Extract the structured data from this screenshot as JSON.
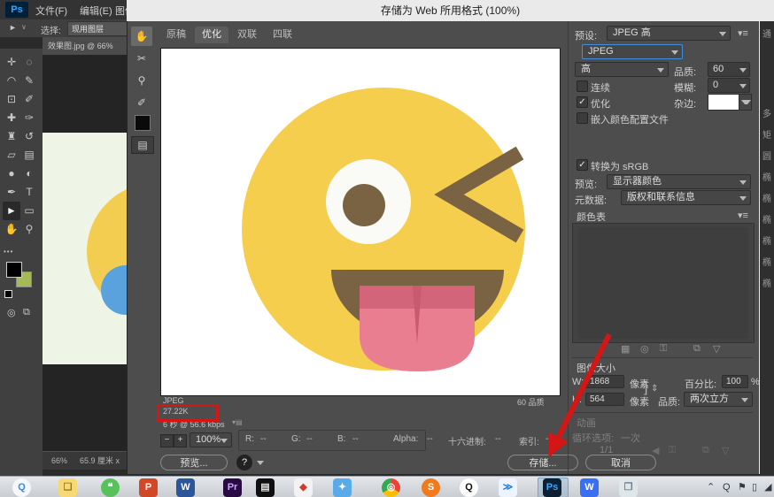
{
  "menubar": {
    "logo": "Ps",
    "items": [
      {
        "label": "文件(F)"
      },
      {
        "label": "编辑(E)"
      },
      {
        "label": "图像"
      }
    ]
  },
  "optionsbar": {
    "tool_glyph": "►",
    "caret_glyph": "∨",
    "select_label": "选择:",
    "select_value": "现用图层"
  },
  "toolpanel": {
    "tools": [
      {
        "name": "move-tool",
        "glyph": "✛"
      },
      {
        "name": "marquee-tool",
        "glyph": "◌"
      },
      {
        "name": "lasso-tool",
        "glyph": "◠"
      },
      {
        "name": "quick-selection-tool",
        "glyph": "✎"
      },
      {
        "name": "crop-tool",
        "glyph": "⊡"
      },
      {
        "name": "eyedropper-tool",
        "glyph": "✐"
      },
      {
        "name": "healing-brush-tool",
        "glyph": "✚"
      },
      {
        "name": "brush-tool",
        "glyph": "✑"
      },
      {
        "name": "clone-stamp-tool",
        "glyph": "♜"
      },
      {
        "name": "history-brush-tool",
        "glyph": "↺"
      },
      {
        "name": "eraser-tool",
        "glyph": "▱"
      },
      {
        "name": "gradient-tool",
        "glyph": "▤"
      },
      {
        "name": "blur-tool",
        "glyph": "●"
      },
      {
        "name": "dodge-tool",
        "glyph": "◐"
      },
      {
        "name": "pen-tool",
        "glyph": "✒"
      },
      {
        "name": "type-tool",
        "glyph": "T"
      },
      {
        "name": "path-selection-tool",
        "glyph": "►",
        "selected": true
      },
      {
        "name": "rectangle-tool",
        "glyph": "▭"
      },
      {
        "name": "hand-tool",
        "glyph": "✋"
      },
      {
        "name": "zoom-tool",
        "glyph": "⚲"
      }
    ],
    "more_glyph": "•••",
    "foreground_color": "#000000",
    "background_color": "#a6b959"
  },
  "document": {
    "tab_title": "效果图.jpg @ 66%",
    "zoom": "66%",
    "dimensions": "65.9 厘米 x",
    "canvas_color": "#eef4e6",
    "emoji_yellow": "#f2cd50",
    "emoji_blue": "#5aa2dd"
  },
  "dialog": {
    "title": "存储为 Web 所用格式 (100%)",
    "tabs": [
      {
        "label": "原稿"
      },
      {
        "label": "优化",
        "active": true
      },
      {
        "label": "双联"
      },
      {
        "label": "四联"
      }
    ],
    "side_tools": [
      {
        "name": "hand-tool",
        "glyph": "✋",
        "selected": true
      },
      {
        "name": "slice-select-tool",
        "glyph": "✂"
      },
      {
        "name": "zoom-tool",
        "glyph": "⚲"
      },
      {
        "name": "eyedropper-tool",
        "glyph": "✐"
      }
    ],
    "toggle_slices_glyph": "▤",
    "preview_info": {
      "format": "JPEG",
      "filesize": "27.22K",
      "download_time": "6 秒 @ 56.6 kbps",
      "download_menu_glyph": "▾▤",
      "quality_note": "60 品质"
    },
    "statusbar": {
      "zoom_out": "−",
      "zoom_in": "+",
      "zoom": "100%",
      "r_label": "R:",
      "r_value": "--",
      "g_label": "G:",
      "g_value": "--",
      "b_label": "B:",
      "b_value": "--",
      "alpha_label": "Alpha:",
      "alpha_value": "--",
      "hex_label": "十六进制:",
      "hex_value": "--",
      "index_label": "索引:",
      "index_value": "--"
    },
    "footer": {
      "preview_button": "预览...",
      "browser_glyph": "?",
      "save_button": "存储...",
      "cancel_button": "取消"
    },
    "settings": {
      "preset_label": "预设:",
      "preset_value": "JPEG 高",
      "menu_glyph": "▾≡",
      "format_value": "JPEG",
      "compression_value": "高",
      "quality_label": "品质:",
      "quality_value": "60",
      "progressive_label": "连续",
      "blur_label": "模糊:",
      "blur_value": "0",
      "optimized_label": "优化",
      "matte_label": "杂边:",
      "matte_color": "#ffffff",
      "embed_label": "嵌入颜色配置文件",
      "srgb_label": "转换为 sRGB",
      "preview_label": "预览:",
      "preview_value": "显示器颜色",
      "metadata_label": "元数据:",
      "metadata_value": "版权和联系信息"
    },
    "color_table": {
      "title": "颜色表",
      "menu_glyph": "▾≡",
      "icons": [
        {
          "name": "dither-icon",
          "glyph": "▦"
        },
        {
          "name": "websnap-icon",
          "glyph": "◎"
        },
        {
          "name": "lock-color-icon",
          "glyph": "⚿"
        },
        {
          "name": "new-color-icon",
          "glyph": "⧉"
        },
        {
          "name": "delete-color-icon",
          "glyph": "▽"
        }
      ]
    },
    "image_size": {
      "title": "图像大小",
      "w_label": "W:",
      "w_value": "1868",
      "unit_w": "像素",
      "h_label": "H:",
      "h_value": "564",
      "unit_h": "像素",
      "link_glyph": "]",
      "link_arrows": "⇕",
      "percent_label": "百分比:",
      "percent_value": "100",
      "percent_unit": "%",
      "quality_label": "品质:",
      "quality_value": "两次立方"
    },
    "animation": {
      "title": "动画",
      "loop_label": "循环选项:",
      "loop_value": "一次",
      "frame_value": "1/1",
      "icons": [
        {
          "name": "previous-frame-icon",
          "glyph": "◀"
        },
        {
          "name": "lock-frame-icon",
          "glyph": "⚿"
        },
        {
          "name": "duplicate-frame-icon",
          "glyph": "⧉"
        },
        {
          "name": "delete-frame-icon",
          "glyph": "▽"
        }
      ]
    }
  },
  "side_panel_chars": [
    "通",
    "多",
    "矩",
    "圆",
    "椭",
    "椭",
    "椭",
    "椭",
    "椭",
    "椭"
  ],
  "taskbar": {
    "icons": [
      {
        "name": "taskbar-qq-browser-icon",
        "glyph": "Q",
        "bg": "#f5f7fa",
        "fg": "#2a8ff0",
        "round": true
      },
      {
        "name": "taskbar-file-explorer-icon",
        "glyph": "❏",
        "bg": "#f7d877",
        "fg": "#9c7a1e"
      },
      {
        "name": "taskbar-wechat-icon",
        "glyph": "❝",
        "bg": "#57c25a",
        "fg": "#ffffff",
        "round": true
      },
      {
        "name": "taskbar-powerpoint-icon",
        "glyph": "P",
        "bg": "#d24726",
        "fg": "#ffffff"
      },
      {
        "name": "taskbar-word-icon",
        "glyph": "W",
        "bg": "#2b579a",
        "fg": "#ffffff"
      },
      {
        "name": "taskbar-premiere-icon",
        "glyph": "Pr",
        "bg": "#2a0a43",
        "fg": "#c4a5f7"
      },
      {
        "name": "taskbar-media-player-icon",
        "glyph": "▤",
        "bg": "#101010",
        "fg": "#e0e0e0"
      },
      {
        "name": "taskbar-format-factory-icon",
        "glyph": "◆",
        "bg": "#f2f2f2",
        "fg": "#d23a2e"
      },
      {
        "name": "taskbar-rabbit-app-icon",
        "glyph": "✦",
        "bg": "#58aae8",
        "fg": "#ffffff"
      },
      {
        "name": "taskbar-chrome-icon",
        "glyph": "◎",
        "bg": "conic-gradient(#ea4335 0 33%, #fbbc05 33% 66%, #34a853 66% 100%)",
        "fg": "#ffffff",
        "round": true
      },
      {
        "name": "taskbar-sogou-browser-icon",
        "glyph": "S",
        "bg": "#f07a1d",
        "fg": "#ffffff",
        "round": true
      },
      {
        "name": "taskbar-qq-icon",
        "glyph": "Q",
        "bg": "#fdfdfd",
        "fg": "#111111",
        "round": true
      },
      {
        "name": "taskbar-thunder-icon",
        "glyph": "≫",
        "bg": "#eef4fd",
        "fg": "#1f7be0"
      },
      {
        "name": "taskbar-photoshop-icon",
        "glyph": "Ps",
        "bg": "#0d1f33",
        "fg": "#34a8ff",
        "active": true
      },
      {
        "name": "taskbar-wps-icon",
        "glyph": "W",
        "bg": "#3a6ff2",
        "fg": "#ffffff"
      },
      {
        "name": "taskbar-3d-box-icon",
        "glyph": "❐",
        "bg": "#dfe6ea",
        "fg": "#6a7f8e"
      }
    ],
    "tray": [
      {
        "name": "tray-expand-icon",
        "glyph": "⌃"
      },
      {
        "name": "tray-qq-icon",
        "glyph": "Q"
      },
      {
        "name": "tray-alert-icon",
        "glyph": "⚑"
      },
      {
        "name": "tray-device-icon",
        "glyph": "▯"
      },
      {
        "name": "tray-network-icon",
        "glyph": "◢"
      }
    ]
  },
  "emoji": {
    "face": "#f6ce4e",
    "feature": "#7a6342",
    "eye_white": "#fafaf6",
    "tongue": "#e87e90",
    "tongue_shadow": "#d4647a",
    "tongue_notch": "#c95a70"
  },
  "annotation_color": "#d41616"
}
